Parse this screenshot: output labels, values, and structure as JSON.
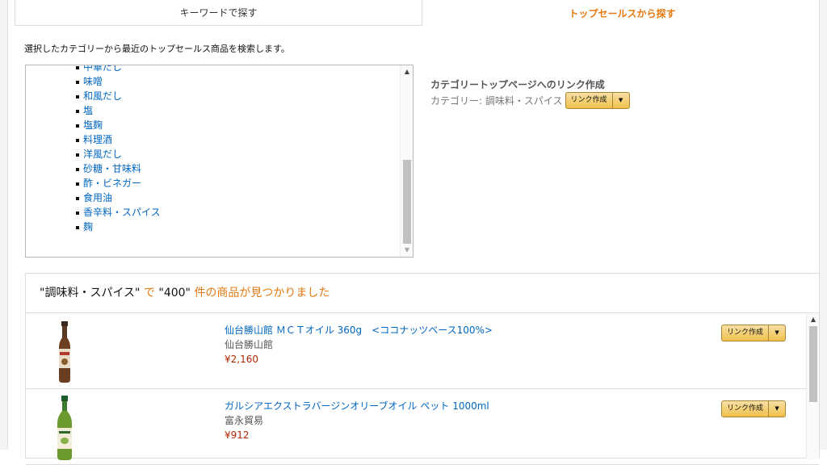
{
  "tabs": {
    "keyword": "キーワードで探す",
    "topsales": "トップセールスから探す"
  },
  "description": "選択したカテゴリーから最近のトップセールス商品を検索します。",
  "categories": [
    "中華だし",
    "味噌",
    "和風だし",
    "塩",
    "塩麹",
    "料理酒",
    "洋風だし",
    "砂糖・甘味料",
    "酢・ビネガー",
    "食用油",
    "香辛料・スパイス",
    "麹"
  ],
  "category_link": {
    "title": "カテゴリートップページへのリンク作成",
    "label": "カテゴリー: 調味料・スパイス",
    "button": "リンク作成"
  },
  "results": {
    "query": "\"調味料・スパイス\"",
    "de": "で",
    "count": "\"400\"",
    "found": "件の商品が見つかりました",
    "items": [
      {
        "title": "仙台勝山館 ＭＣＴオイル 360g　<ココナッツベース100%>",
        "maker": "仙台勝山館",
        "price": "¥2,160",
        "button": "リンク作成"
      },
      {
        "title": "ガルシアエクストラバージンオリーブオイル ペット 1000ml",
        "maker": "富永貿易",
        "price": "¥912",
        "button": "リンク作成"
      }
    ]
  },
  "icons": {
    "scroll_up": "scroll-up-arrow-icon",
    "scroll_down": "scroll-down-arrow-icon",
    "dropdown": "caret-down-icon"
  },
  "colors": {
    "accent": "#e47911",
    "link": "#0066c0",
    "price": "#b12704",
    "button": "#f0c14b"
  }
}
